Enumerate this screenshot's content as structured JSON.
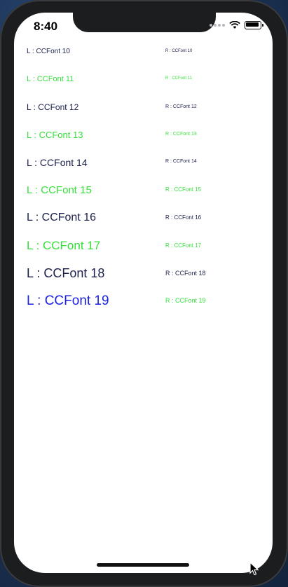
{
  "status_bar": {
    "time": "8:40",
    "signal_icon": "cellular-dots-icon",
    "wifi_icon": "wifi-icon",
    "battery_icon": "battery-icon"
  },
  "colors": {
    "navy": "#1a1f4a",
    "green": "#35e03a",
    "blue": "#1d22e0"
  },
  "rows": [
    {
      "left": "L : CCFont 10",
      "right": "R : CCFont 10"
    },
    {
      "left": "L : CCFont 11",
      "right": "R : CCFont 11"
    },
    {
      "left": "L : CCFont 12",
      "right": "R : CCFont 12"
    },
    {
      "left": "L : CCFont 13",
      "right": "R : CCFont 13"
    },
    {
      "left": "L : CCFont 14",
      "right": "R : CCFont 14"
    },
    {
      "left": "L : CCFont 15",
      "right": "R : CCFont 15"
    },
    {
      "left": "L : CCFont 16",
      "right": "R : CCFont 16"
    },
    {
      "left": "L : CCFont 17",
      "right": "R : CCFont 17"
    },
    {
      "left": "L : CCFont 18",
      "right": "R : CCFont 18"
    },
    {
      "left": "L : CCFont 19",
      "right": "R : CCFont 19"
    }
  ]
}
